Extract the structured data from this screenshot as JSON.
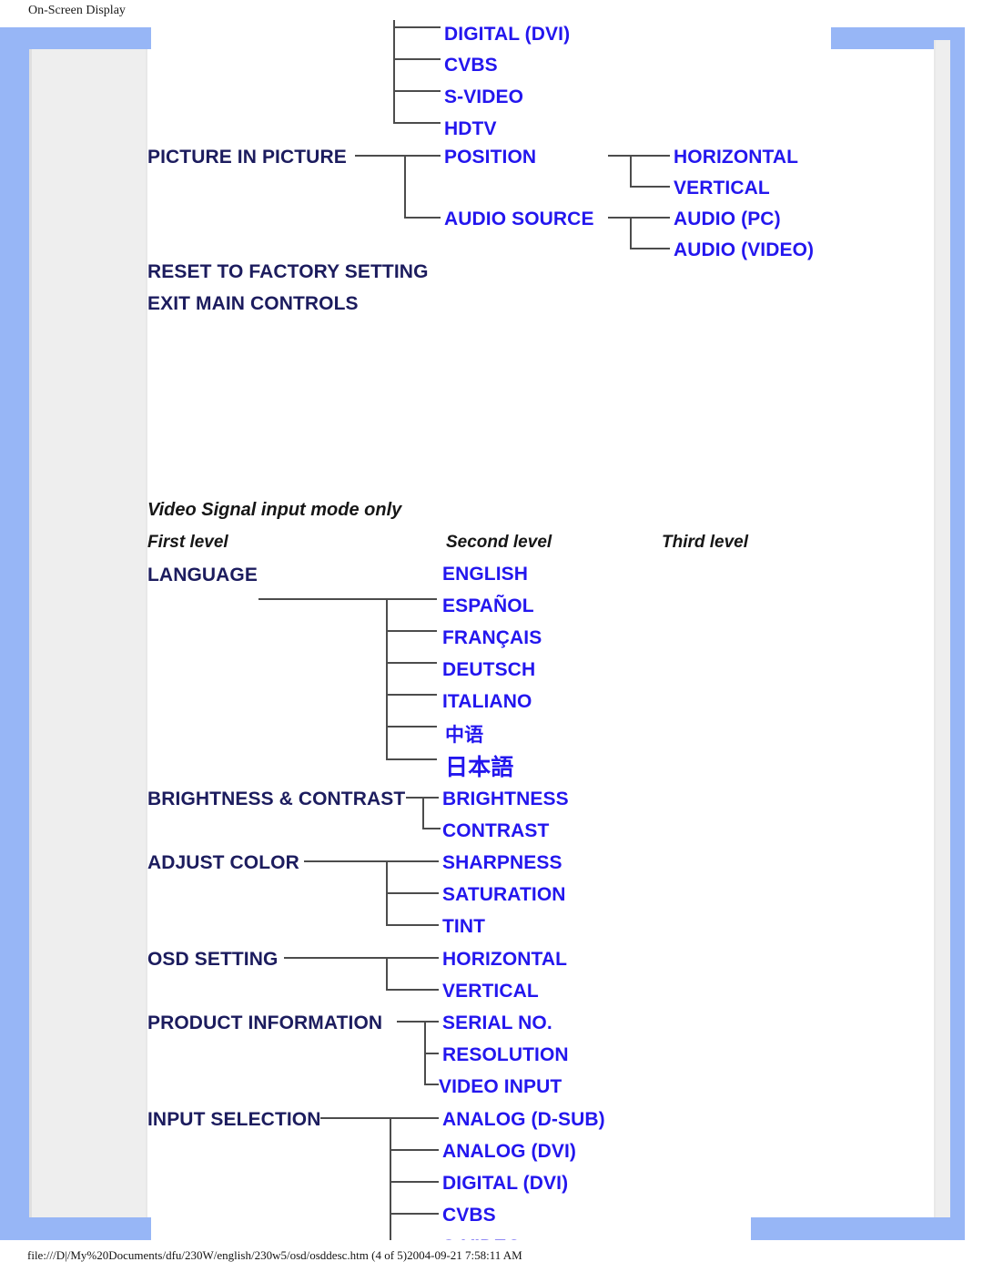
{
  "document": {
    "header": "On-Screen Display",
    "footer": "file:///D|/My%20Documents/dfu/230W/english/230w5/osd/osddesc.htm (4 of 5)2004-09-21 7:58:11 AM"
  },
  "colors": {
    "level1_text": "#1c1c5e",
    "level2_text": "#2316ee",
    "level3_text": "#2316ee",
    "connector": "#4c4c4c",
    "frame_blue": "#97b6f6",
    "frame_panel": "#eeeeee",
    "background": "#ffffff"
  },
  "top_diagram": {
    "continued_branch": {
      "note": "continuation of a branch from the previous page",
      "items": [
        "DIGITAL (DVI)",
        "CVBS",
        "S-VIDEO",
        "HDTV"
      ]
    },
    "first_level": [
      "PICTURE IN PICTURE",
      "RESET TO FACTORY SETTING",
      "EXIT MAIN CONTROLS"
    ],
    "picture_in_picture": {
      "label": "PICTURE IN PICTURE",
      "children": [
        {
          "label": "POSITION",
          "children": [
            "HORIZONTAL",
            "VERTICAL"
          ]
        },
        {
          "label": "AUDIO SOURCE",
          "children": [
            "AUDIO (PC)",
            "AUDIO (VIDEO)"
          ]
        }
      ]
    }
  },
  "video_section": {
    "title": "Video Signal input mode only",
    "column_headers": {
      "first": "First level",
      "second": "Second level",
      "third": "Third level"
    },
    "menu": [
      {
        "label": "LANGUAGE",
        "children": [
          "ENGLISH",
          "ESPAÑOL",
          "FRANÇAIS",
          "DEUTSCH",
          "ITALIANO",
          "中语",
          "日本語"
        ]
      },
      {
        "label": "BRIGHTNESS & CONTRAST",
        "children": [
          "BRIGHTNESS",
          "CONTRAST"
        ]
      },
      {
        "label": "ADJUST COLOR",
        "children": [
          "SHARPNESS",
          "SATURATION",
          "TINT"
        ]
      },
      {
        "label": "OSD SETTING",
        "children": [
          "HORIZONTAL",
          "VERTICAL"
        ]
      },
      {
        "label": "PRODUCT INFORMATION",
        "children": [
          "SERIAL NO.",
          "RESOLUTION",
          "VIDEO INPUT"
        ]
      },
      {
        "label": "INPUT SELECTION",
        "children": [
          "ANALOG (D-SUB)",
          "ANALOG (DVI)",
          "DIGITAL (DVI)",
          "CVBS",
          "S-VIDEO"
        ]
      }
    ]
  }
}
